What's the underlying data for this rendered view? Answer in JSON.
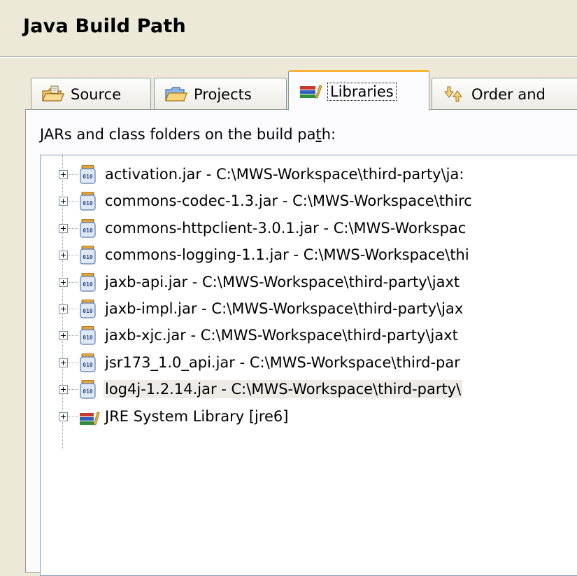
{
  "header": {
    "title": "Java Build Path"
  },
  "tabs": [
    {
      "label": "Source",
      "icon": "source-folder-icon",
      "active": false
    },
    {
      "label": "Projects",
      "icon": "projects-folder-icon",
      "active": false
    },
    {
      "label": "Libraries",
      "icon": "libraries-icon",
      "active": true
    },
    {
      "label": "Order and",
      "icon": "order-export-icon",
      "active": false
    }
  ],
  "libraries": {
    "label_prefix": "JARs and class folders on the build pa",
    "label_mnemonic": "t",
    "label_suffix": "h:",
    "items": [
      {
        "text": "activation.jar - C:\\MWS-Workspace\\third-party\\ja:",
        "icon": "jar-icon"
      },
      {
        "text": "commons-codec-1.3.jar - C:\\MWS-Workspace\\thirc",
        "icon": "jar-icon"
      },
      {
        "text": "commons-httpclient-3.0.1.jar - C:\\MWS-Workspac",
        "icon": "jar-icon"
      },
      {
        "text": "commons-logging-1.1.jar - C:\\MWS-Workspace\\thi",
        "icon": "jar-icon"
      },
      {
        "text": "jaxb-api.jar - C:\\MWS-Workspace\\third-party\\jaxt",
        "icon": "jar-icon"
      },
      {
        "text": "jaxb-impl.jar - C:\\MWS-Workspace\\third-party\\jax",
        "icon": "jar-icon"
      },
      {
        "text": "jaxb-xjc.jar - C:\\MWS-Workspace\\third-party\\jaxt",
        "icon": "jar-icon"
      },
      {
        "text": "jsr173_1.0_api.jar - C:\\MWS-Workspace\\third-par",
        "icon": "jar-icon"
      },
      {
        "text": "log4j-1.2.14.jar - C:\\MWS-Workspace\\third-party\\",
        "icon": "jar-icon",
        "selected": true
      },
      {
        "text": "JRE System Library [jre6]",
        "icon": "library-icon"
      }
    ]
  },
  "colors": {
    "active_tab_accent": "#f9b234",
    "background": "#ece9d8",
    "tree_border": "#7f9db9"
  }
}
